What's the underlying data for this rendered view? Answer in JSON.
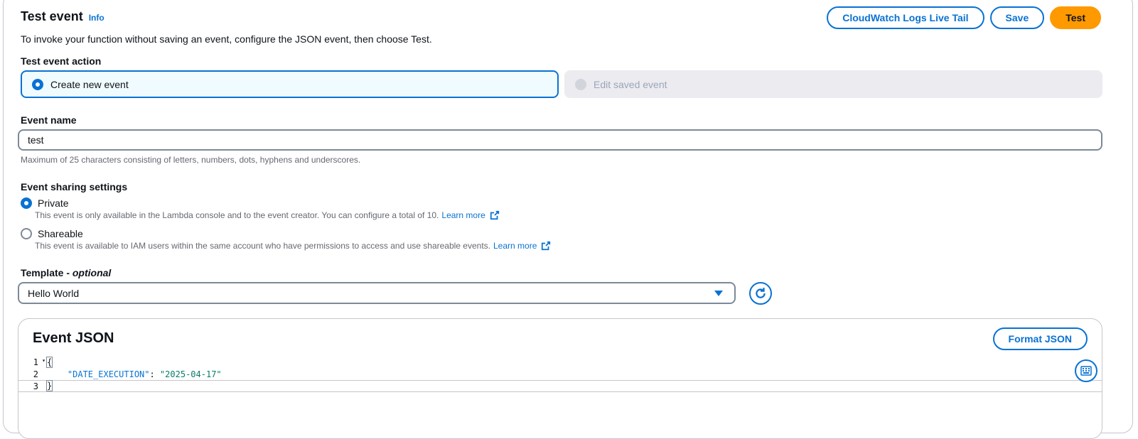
{
  "header": {
    "title": "Test event",
    "info_link": "Info",
    "description": "To invoke your function without saving an event, configure the JSON event, then choose Test."
  },
  "actions": {
    "live_tail_label": "CloudWatch Logs Live Tail",
    "save_label": "Save",
    "test_label": "Test"
  },
  "test_event_action": {
    "label": "Test event action",
    "options": [
      {
        "label": "Create new event",
        "selected": true,
        "disabled": false
      },
      {
        "label": "Edit saved event",
        "selected": false,
        "disabled": true
      }
    ]
  },
  "event_name": {
    "label": "Event name",
    "value": "test",
    "hint": "Maximum of 25 characters consisting of letters, numbers, dots, hyphens and underscores."
  },
  "sharing": {
    "label": "Event sharing settings",
    "private": {
      "label": "Private",
      "description": "This event is only available in the Lambda console and to the event creator. You can configure a total of 10.",
      "learn_more": "Learn more",
      "selected": true
    },
    "shareable": {
      "label": "Shareable",
      "description": "This event is available to IAM users within the same account who have permissions to access and use shareable events.",
      "learn_more": "Learn more",
      "selected": false
    }
  },
  "template": {
    "label_main": "Template - ",
    "label_optional": "optional",
    "selected": "Hello World"
  },
  "event_json": {
    "title": "Event JSON",
    "format_label": "Format JSON",
    "lines": [
      {
        "number": "1",
        "open": "{"
      },
      {
        "number": "2",
        "key": "\"DATE_EXECUTION\"",
        "sep": ": ",
        "value": "\"2025-04-17\""
      },
      {
        "number": "3",
        "close": "}"
      }
    ]
  },
  "colors": {
    "accent": "#0972d3",
    "primary_button": "#ff9900",
    "selected_tile_bg": "#f0fbff",
    "disabled_tile_bg": "#ebebf0",
    "json_string": "#067d68"
  }
}
